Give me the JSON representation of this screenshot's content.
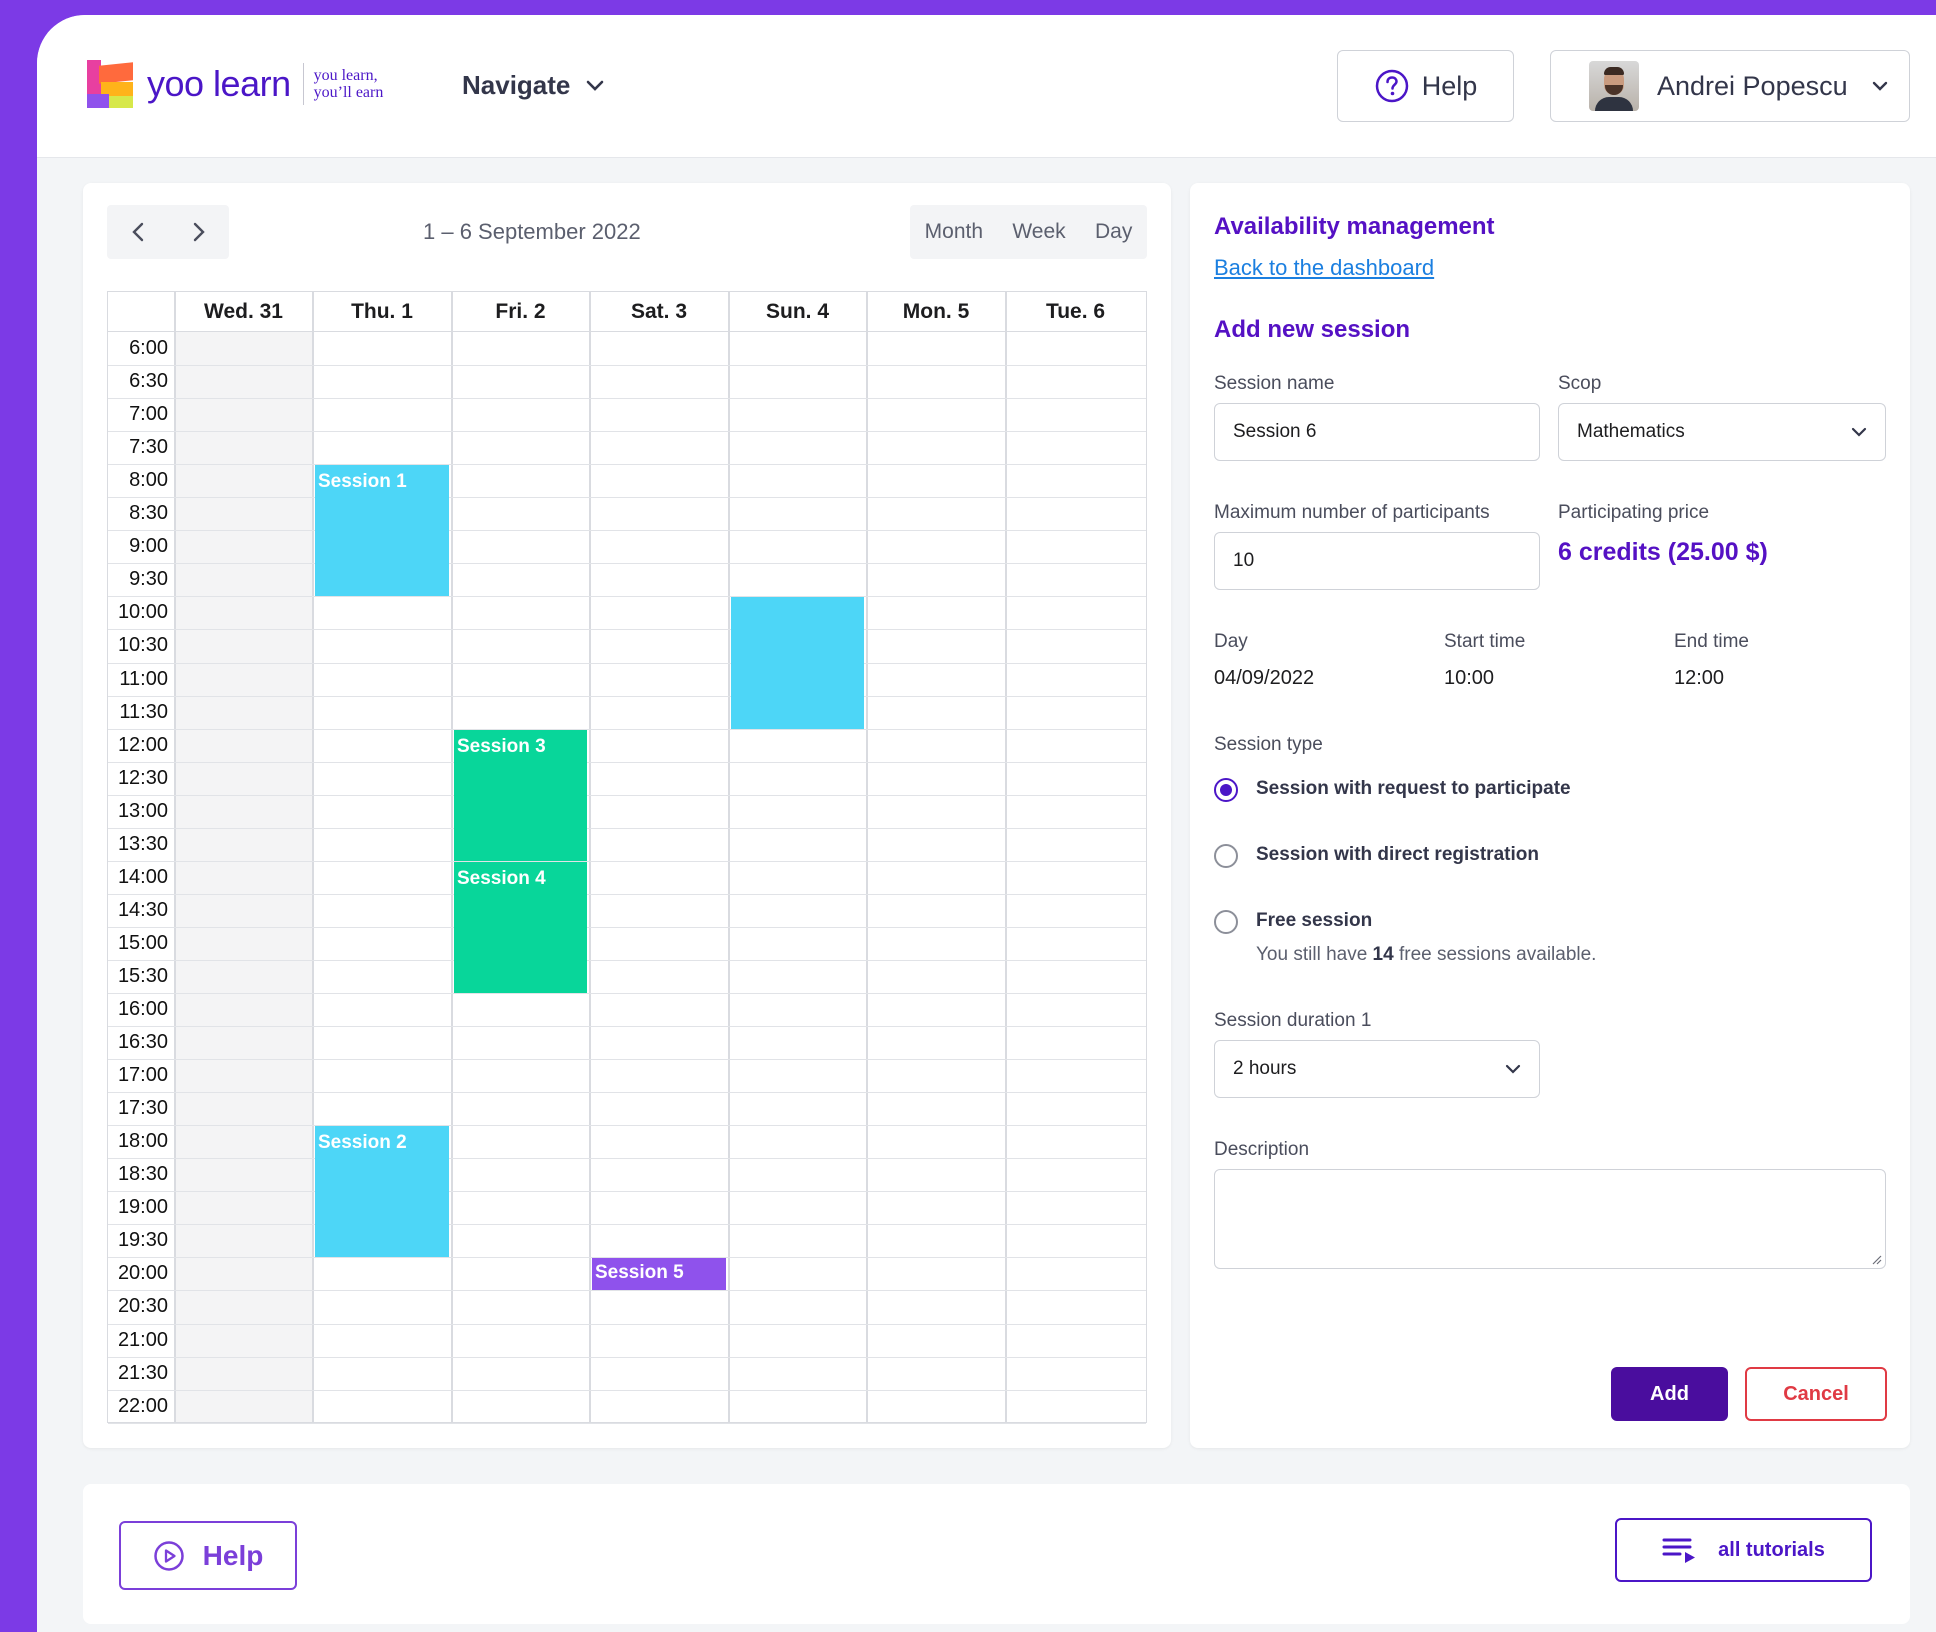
{
  "header": {
    "logo_text": "yoo learn",
    "tagline_1": "you learn,",
    "tagline_2": "you’ll earn",
    "nav_label": "Navigate",
    "help_label": "Help",
    "user_name": "Andrei Popescu"
  },
  "calendar": {
    "range_label": "1 – 6 September 2022",
    "views": [
      "Month",
      "Week",
      "Day"
    ],
    "days": [
      "Wed. 31",
      "Thu. 1",
      "Fri. 2",
      "Sat. 3",
      "Sun. 4",
      "Mon. 5",
      "Tue. 6"
    ],
    "times": [
      "6:00",
      "6:30",
      "7:00",
      "7:30",
      "8:00",
      "8:30",
      "9:00",
      "9:30",
      "10:00",
      "10:30",
      "11:00",
      "11:30",
      "12:00",
      "12:30",
      "13:00",
      "13:30",
      "14:00",
      "14:30",
      "15:00",
      "15:30",
      "16:00",
      "16:30",
      "17:00",
      "17:30",
      "18:00",
      "18:30",
      "19:00",
      "19:30",
      "20:00",
      "20:30",
      "21:00",
      "21:30",
      "22:00"
    ],
    "events": [
      {
        "title": "Session 1",
        "day": 1,
        "start": "8:00",
        "end": "10:00",
        "color": "#4dd6f7"
      },
      {
        "title": "",
        "day": 4,
        "start": "10:00",
        "end": "12:00",
        "color": "#4dd6f7"
      },
      {
        "title": "Session 3",
        "day": 2,
        "start": "12:00",
        "end": "14:00",
        "color": "#08d69a"
      },
      {
        "title": "Session 4",
        "day": 2,
        "start": "14:00",
        "end": "16:00",
        "color": "#08d69a"
      },
      {
        "title": "Session 2",
        "day": 1,
        "start": "18:00",
        "end": "20:00",
        "color": "#4dd6f7"
      },
      {
        "title": "Session 5",
        "day": 3,
        "start": "20:00",
        "end": "20:30",
        "color": "#8f52ec"
      }
    ]
  },
  "form": {
    "title": "Availability management",
    "back_link": "Back to the dashboard",
    "section_title": "Add new session",
    "session_name_label": "Session name",
    "session_name_value": "Session 6",
    "scope_label": "Scop",
    "scope_value": "Mathematics",
    "max_participants_label": "Maximum number of participants",
    "max_participants_value": "10",
    "price_label": "Participating price",
    "price_value": "6 credits (25.00 $)",
    "day_label": "Day",
    "day_value": "04/09/2022",
    "start_label": "Start time",
    "start_value": "10:00",
    "end_label": "End time",
    "end_value": "12:00",
    "type_label": "Session type",
    "type_options": [
      "Session with request to participate",
      "Session with direct registration",
      "Free session"
    ],
    "free_note_prefix": "You still have ",
    "free_note_count": "14",
    "free_note_suffix": " free sessions available.",
    "duration_label": "Session duration 1",
    "duration_value": "2 hours",
    "description_label": "Description",
    "description_value": "",
    "add_label": "Add",
    "cancel_label": "Cancel"
  },
  "footer": {
    "help_label": "Help",
    "tutorials_label": "all tutorials"
  },
  "colors": {
    "brand": "#4b16c7",
    "session_blue": "#4dd6f7",
    "session_green": "#08d69a",
    "session_purple": "#8f52ec",
    "cancel_red": "#e03a44"
  }
}
